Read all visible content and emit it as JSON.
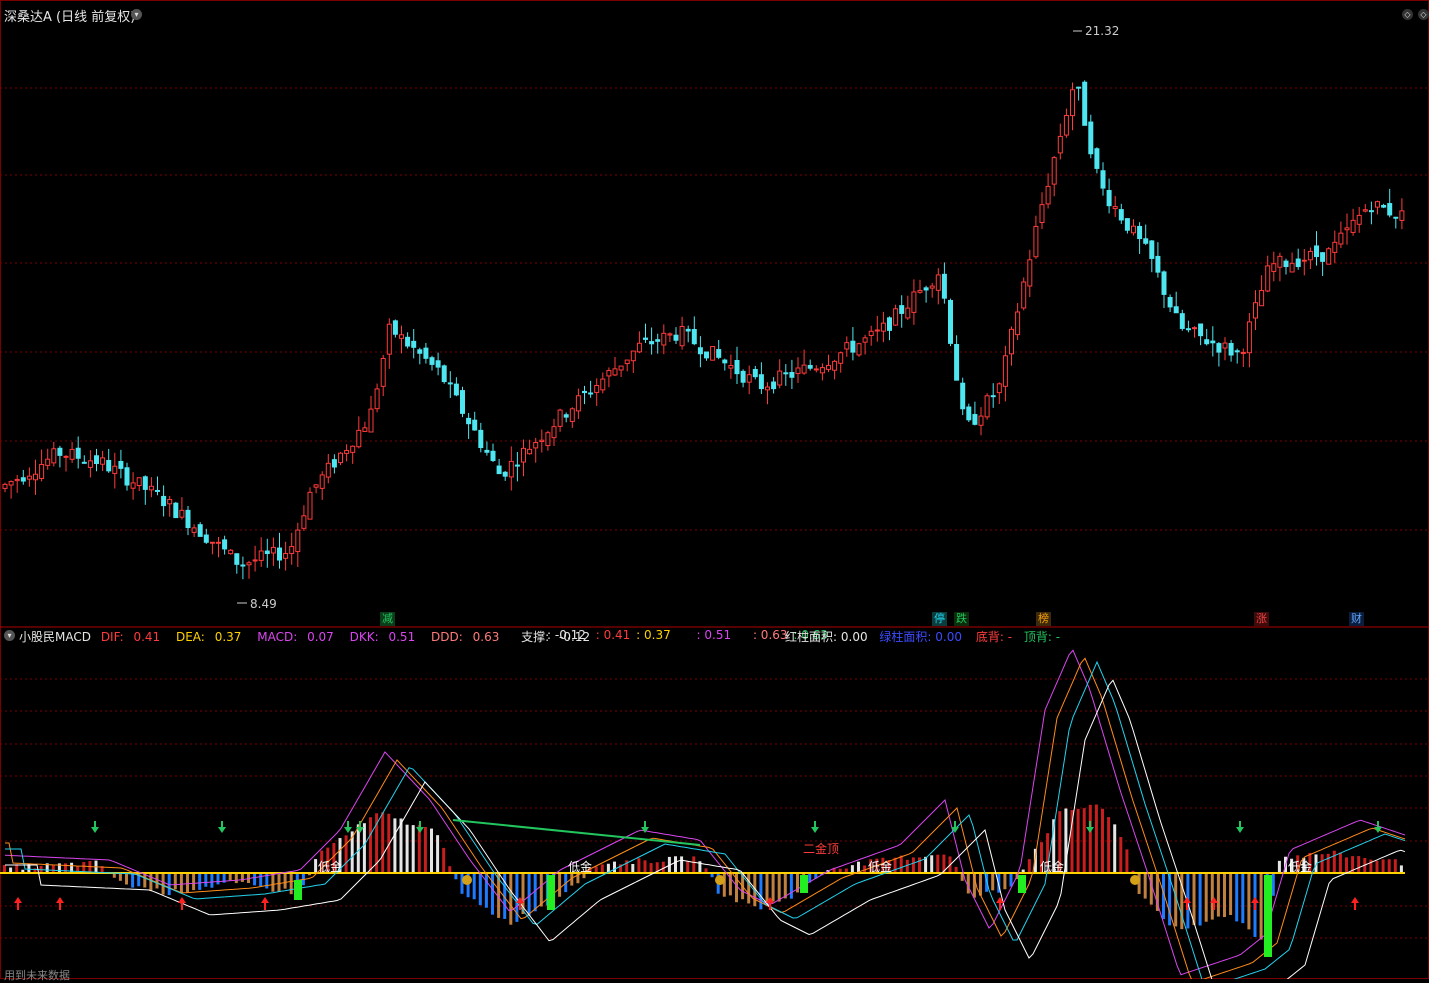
{
  "top_header": {
    "stock_title": "深桑达A",
    "period_label": "(日线 前复权)",
    "high_label": "21.32",
    "low_label": "8.49"
  },
  "event_markers": [
    {
      "text": "减",
      "color": "#22c55e",
      "bg": "#0b3d1a"
    },
    {
      "text": "停",
      "color": "#22d3ee",
      "bg": "#0b3d3d"
    },
    {
      "text": "跌",
      "color": "#22c55e",
      "bg": "#0b2d0b"
    },
    {
      "text": "榜",
      "color": "#f59e0b",
      "bg": "#3d2a0b"
    },
    {
      "text": "涨",
      "color": "#ef4444",
      "bg": "#3d0b0b"
    },
    {
      "text": "财",
      "color": "#60a5fa",
      "bg": "#0b1d3d"
    }
  ],
  "indicator_header": {
    "name": "小股民MACD",
    "dif_label": "DIF:",
    "dif_value": "0.41",
    "dea_label": "DEA:",
    "dea_value": "0.37",
    "macd_label": "MACD:",
    "macd_value": "0.07",
    "dkk_label": "DKK:",
    "dkk_value": "0.51",
    "ddd_label": "DDD:",
    "ddd_value": "0.63",
    "support_label": "支撑:",
    "support_value": "-0.12",
    "v1": ": -0.12",
    "v2": ": 0.41",
    "v3": ": 0.37",
    "v4": ": 0.51",
    "v5": ": 0.63",
    "v6": ": 0.63",
    "red_area_label": "红柱面积:",
    "red_area_value": "0.00",
    "green_area_label": "绿柱面积:",
    "green_area_value": "0.00",
    "bottom_div_label": "底背:",
    "bottom_div_value": "-",
    "top_div_label": "顶背:",
    "top_div_value": "-"
  },
  "annotations": {
    "low_gold": "低金",
    "second_gold_top": "二金顶",
    "footer_text": "用到未来数据"
  },
  "colors": {
    "up": "#ff3b3b",
    "down": "#4ee6f0",
    "grid": "#7a0000",
    "dif": "#ff3b3b",
    "dea": "#ffd200",
    "macd": "#d946ef"
  }
}
